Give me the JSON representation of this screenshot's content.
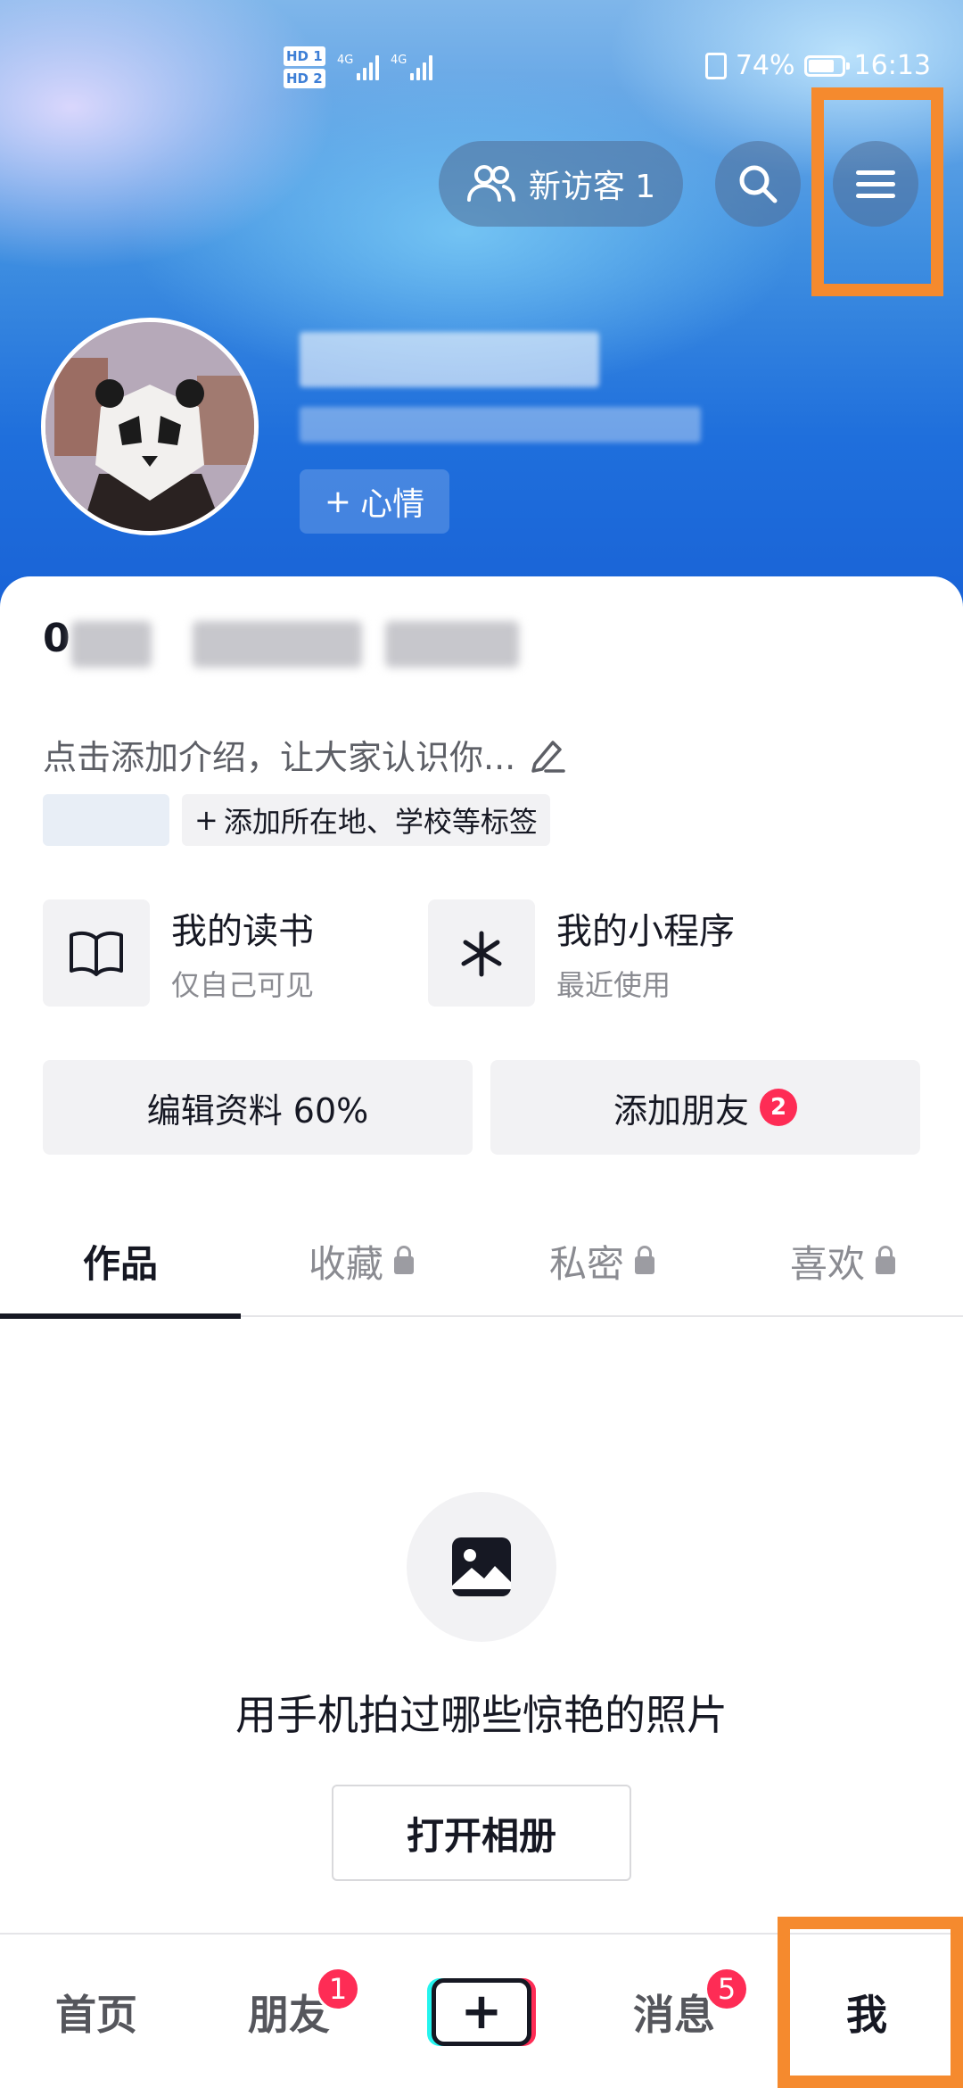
{
  "status_bar": {
    "sim1": "HD 1",
    "sim2": "HD 2",
    "net1": "4G",
    "net2": "4G",
    "battery": "74%",
    "time": "16:13"
  },
  "header": {
    "visitor_label": "新访客 1",
    "search_icon": "search-icon",
    "menu_icon": "hamburger-menu-icon",
    "mood_label": "心情"
  },
  "profile": {
    "stats_prefix": "0",
    "bio_placeholder": "点击添加介绍，让大家认识你...",
    "add_tag_label": "添加所在地、学校等标签"
  },
  "quick_entries": [
    {
      "title": "我的读书",
      "subtitle": "仅自己可见",
      "icon": "book-icon"
    },
    {
      "title": "我的小程序",
      "subtitle": "最近使用",
      "icon": "mini-program-icon"
    }
  ],
  "actions": {
    "edit_profile": "编辑资料 60%",
    "add_friends": "添加朋友",
    "add_friends_badge": "2"
  },
  "tabs": [
    {
      "label": "作品",
      "active": true,
      "locked": false
    },
    {
      "label": "收藏",
      "active": false,
      "locked": true
    },
    {
      "label": "私密",
      "active": false,
      "locked": true
    },
    {
      "label": "喜欢",
      "active": false,
      "locked": true
    }
  ],
  "empty_state": {
    "icon": "image-icon",
    "text": "用手机拍过哪些惊艳的照片",
    "button": "打开相册"
  },
  "bottom_nav": [
    {
      "label": "首页",
      "badge": ""
    },
    {
      "label": "朋友",
      "badge": "1"
    },
    {
      "label": "+",
      "badge": ""
    },
    {
      "label": "消息",
      "badge": "5"
    },
    {
      "label": "我",
      "badge": ""
    }
  ],
  "colors": {
    "highlight": "#f58a2e",
    "badge": "#fe2c55",
    "text": "#161823"
  }
}
